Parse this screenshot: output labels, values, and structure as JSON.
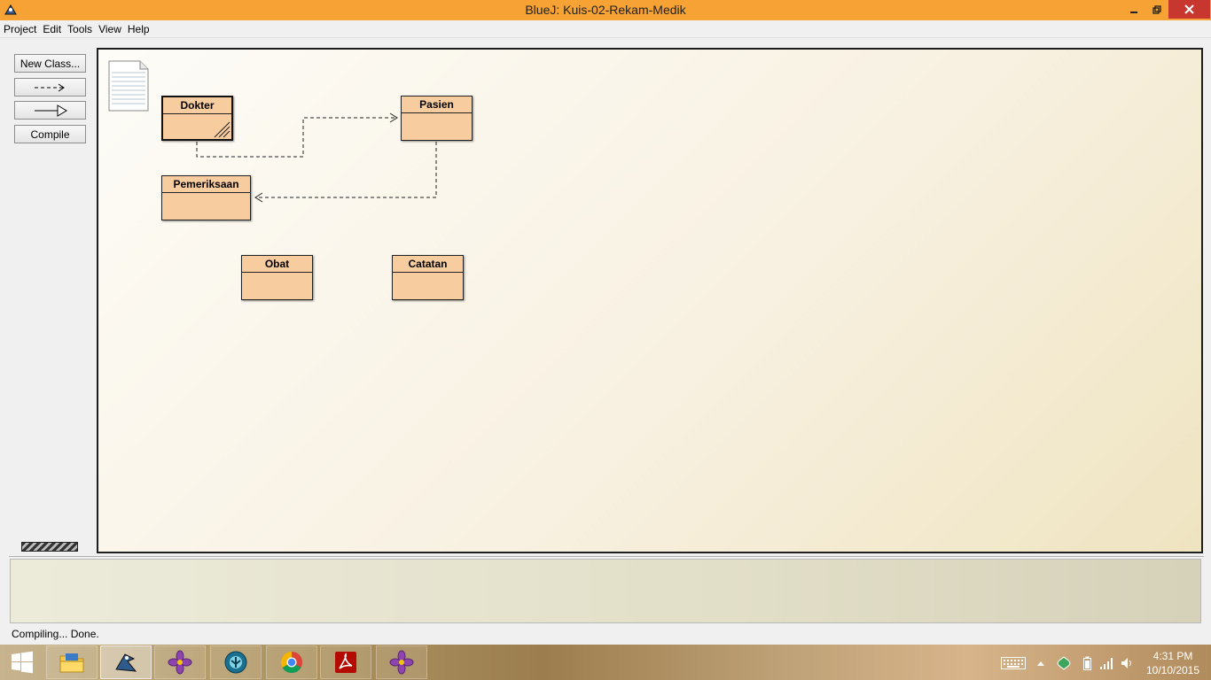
{
  "window": {
    "title": "BlueJ:  Kuis-02-Rekam-Medik"
  },
  "menu": [
    "Project",
    "Edit",
    "Tools",
    "View",
    "Help"
  ],
  "toolbar": {
    "new_class": "New Class...",
    "uses_arrow": "--->",
    "inherit_arrow": "—▷",
    "compile": "Compile"
  },
  "classes": {
    "dokter": "Dokter",
    "pasien": "Pasien",
    "pemeriksaan": "Pemeriksaan",
    "obat": "Obat",
    "catatan": "Catatan"
  },
  "status": {
    "text": "Compiling... Done."
  },
  "taskbar": {
    "items": [
      "start",
      "file-explorer",
      "bluej",
      "purple-flower-app",
      "teal-app",
      "chrome",
      "adobe-reader",
      "purple-flower-app-2"
    ]
  },
  "clock": {
    "time": "4:31 PM",
    "date": "10/10/2015"
  },
  "colors": {
    "titlebar": "#f7a234",
    "close_button": "#c7372f",
    "class_fill": "#f7cc9e",
    "canvas_bg": "#f8f1e2"
  }
}
